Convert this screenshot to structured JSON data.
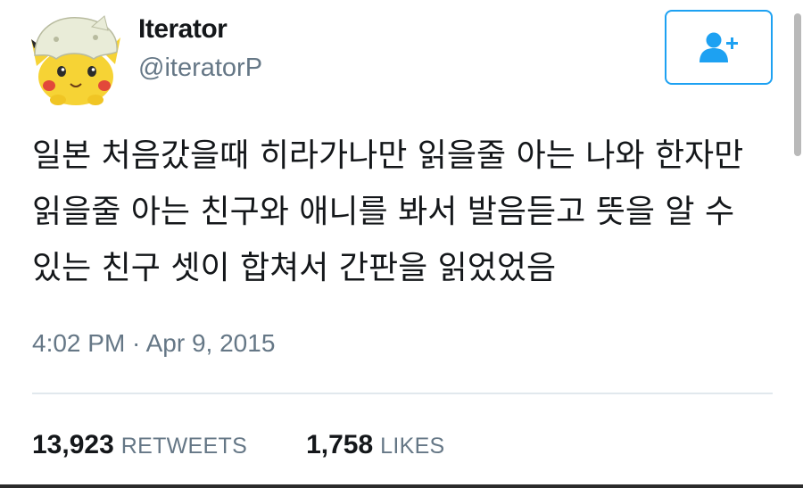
{
  "author": {
    "name": "Iterator",
    "handle": "@iteratorP",
    "avatar_icon": "pikachu-avatar-icon"
  },
  "follow_button": {
    "icon": "add-user-icon",
    "color": "#1da1f2"
  },
  "tweet": {
    "text": "일본 처음갔을때 히라가나만 읽을줄 아는 나와 한자만 읽을줄 아는 친구와 애니를 봐서 발음듣고 뜻을 알 수 있는 친구 셋이 합쳐서 간판을 읽었었음",
    "timestamp": "4:02 PM · Apr 9, 2015"
  },
  "stats": {
    "retweets_count": "13,923",
    "retweets_label": "RETWEETS",
    "likes_count": "1,758",
    "likes_label": "LIKES"
  },
  "colors": {
    "secondary_text": "#657786",
    "primary_text": "#14171a",
    "divider": "#e1e8ed"
  }
}
